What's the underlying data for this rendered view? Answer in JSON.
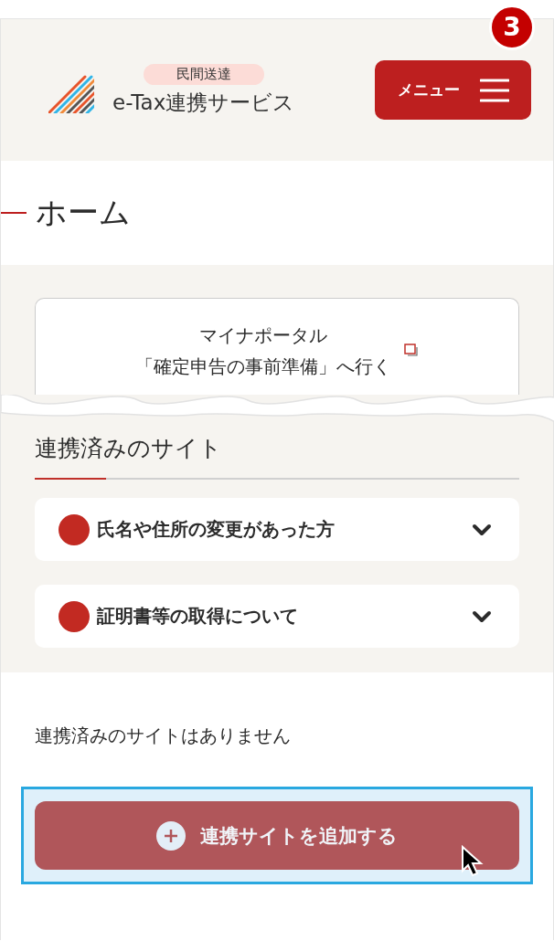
{
  "step_badge": "3",
  "header": {
    "tag": "民間送達",
    "title": "e-Tax連携サービス",
    "menu_button": "メニュー"
  },
  "page_title": "ホーム",
  "portal_link": {
    "lines": [
      "マイナポータル",
      "「確定申告の事前準備」へ行く"
    ]
  },
  "linked_sites": {
    "heading": "連携済みのサイト",
    "items": [
      {
        "label": "氏名や住所の変更があった方",
        "expanded": false
      },
      {
        "label": "証明書等の取得について",
        "expanded": false
      }
    ]
  },
  "empty_message": "連携済みのサイトはありません",
  "add_button": {
    "label": "連携サイトを追加する",
    "highlighted": true
  }
}
